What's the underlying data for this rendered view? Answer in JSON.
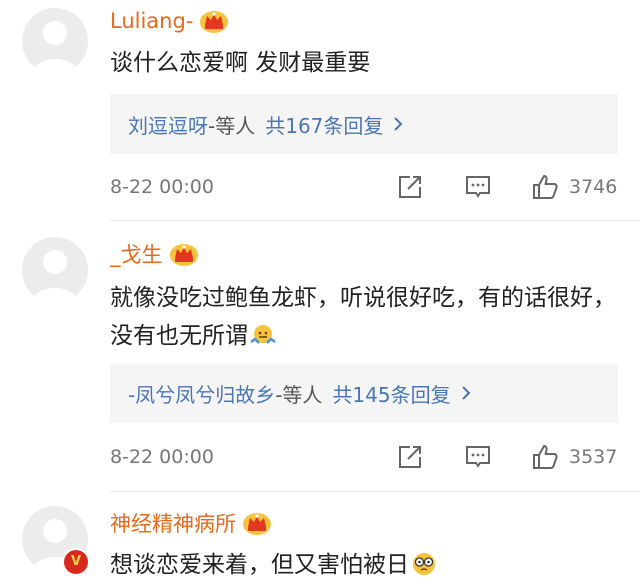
{
  "comments": [
    {
      "username": "Luliang-",
      "text": "谈什么恋爱啊 发财最重要",
      "replies": {
        "names": "刘逗逗呀",
        "suffix": "-等人",
        "count_label": "共167条回复"
      },
      "time": "8-22 00:00",
      "likes": "3746",
      "verified": false
    },
    {
      "username": "_戈生",
      "text": "就像没吃过鲍鱼龙虾，听说很好吃，有的话很好，没有也无所谓",
      "emoji": "shrug-emoji",
      "replies": {
        "names": "-凤兮凤兮归故乡",
        "suffix": "-等人",
        "count_label": "共145条回复"
      },
      "time": "8-22 00:00",
      "likes": "3537",
      "verified": false
    },
    {
      "username": "神经精神病所",
      "text": "想谈恋爱来着，但又害怕被日",
      "emoji": "glasses-emoji",
      "verified": true,
      "verified_label": "V"
    }
  ],
  "colors": {
    "username": "#e86a1a",
    "reply_link": "#4a76b8",
    "reply_bg": "#f5f5f5",
    "meta": "#777777",
    "crown": "#f2a90d",
    "verified_badge": "#d8291f"
  },
  "icons": [
    "crown-icon",
    "chevron-right-icon",
    "share-icon",
    "comment-icon",
    "thumbs-up-icon",
    "avatar-placeholder-icon"
  ]
}
